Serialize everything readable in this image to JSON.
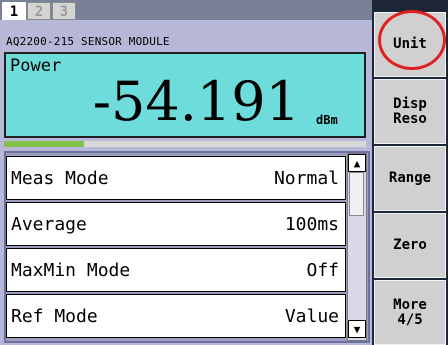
{
  "tabs": [
    "1",
    "2",
    "3"
  ],
  "module_title": "AQ2200-215 SENSOR MODULE",
  "power": {
    "label": "Power",
    "value": "-54.191",
    "unit": "dBm",
    "level_fraction": 0.22
  },
  "settings": [
    {
      "label": "Meas Mode",
      "value": "Normal"
    },
    {
      "label": "Average",
      "value": "100ms"
    },
    {
      "label": "MaxMin Mode",
      "value": "Off"
    },
    {
      "label": "Ref Mode",
      "value": "Value"
    }
  ],
  "scroll": {
    "up": "▲",
    "down": "▼"
  },
  "softkeys": [
    "Unit",
    "Disp\nReso",
    "Range",
    "Zero",
    "More\n4/5"
  ],
  "colors": {
    "display": "#6fdcdc",
    "panel": "#b7b7d7",
    "level_bar": "#84c24a",
    "highlight": "#e02020"
  }
}
